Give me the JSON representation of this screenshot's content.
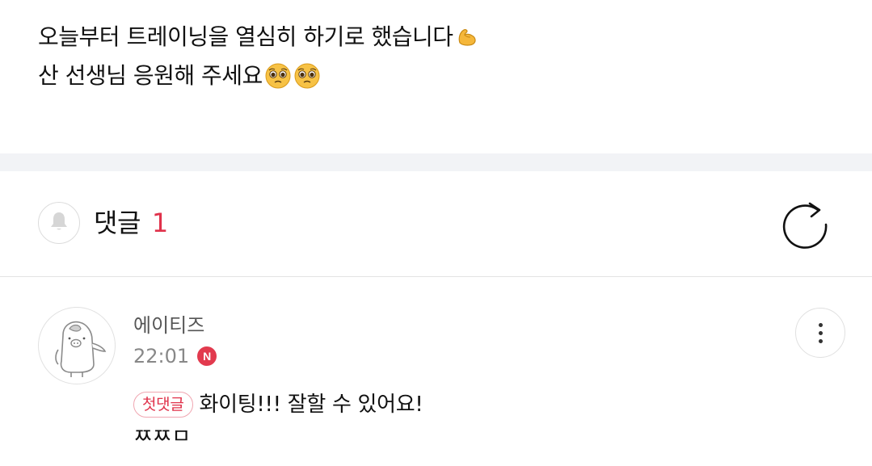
{
  "post": {
    "line1": "오늘부터 트레이닝을 열심히 하기로 했습니다",
    "line1_emoji": "flexed-biceps",
    "line2": "산 선생님 응원해 주세요",
    "line2_emojis": [
      "pleading-face",
      "pleading-face"
    ]
  },
  "comments_header": {
    "title": "댓글",
    "count": "1",
    "notification_icon": "bell-icon",
    "refresh_icon": "refresh-icon"
  },
  "comment": {
    "author": "에이티즈",
    "time": "22:01",
    "new_badge": "N",
    "first_comment_badge": "첫댓글",
    "text_line1": "화이팅!!! 잘할 수 있어요!",
    "text_line2": "ㅉㅉㅁ",
    "avatar_icon": "character-avatar",
    "more_icon": "more-vertical-icon"
  },
  "colors": {
    "accent": "#e0324b",
    "divider_band": "#f2f3f6",
    "meta_text": "#888888"
  }
}
